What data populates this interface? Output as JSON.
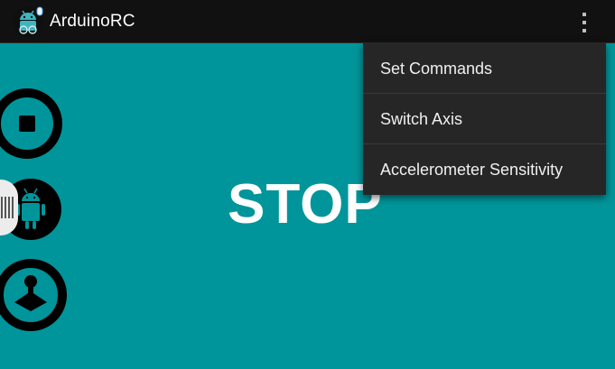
{
  "app": {
    "title": "ArduinoRC",
    "icon": "android-robot-headset-icon"
  },
  "actionbar": {
    "overflow_icon": "overflow-menu-icon"
  },
  "main": {
    "status_text": "STOP"
  },
  "side_buttons": [
    {
      "icon": "stop-icon"
    },
    {
      "icon": "android-icon"
    },
    {
      "icon": "joystick-icon"
    }
  ],
  "menu": {
    "items": [
      {
        "label": "Set Commands"
      },
      {
        "label": "Switch Axis"
      },
      {
        "label": "Accelerometer Sensitivity"
      }
    ]
  },
  "colors": {
    "background": "#00959a",
    "actionbar": "#111111",
    "menu": "#262626",
    "android_green": "#009599"
  }
}
